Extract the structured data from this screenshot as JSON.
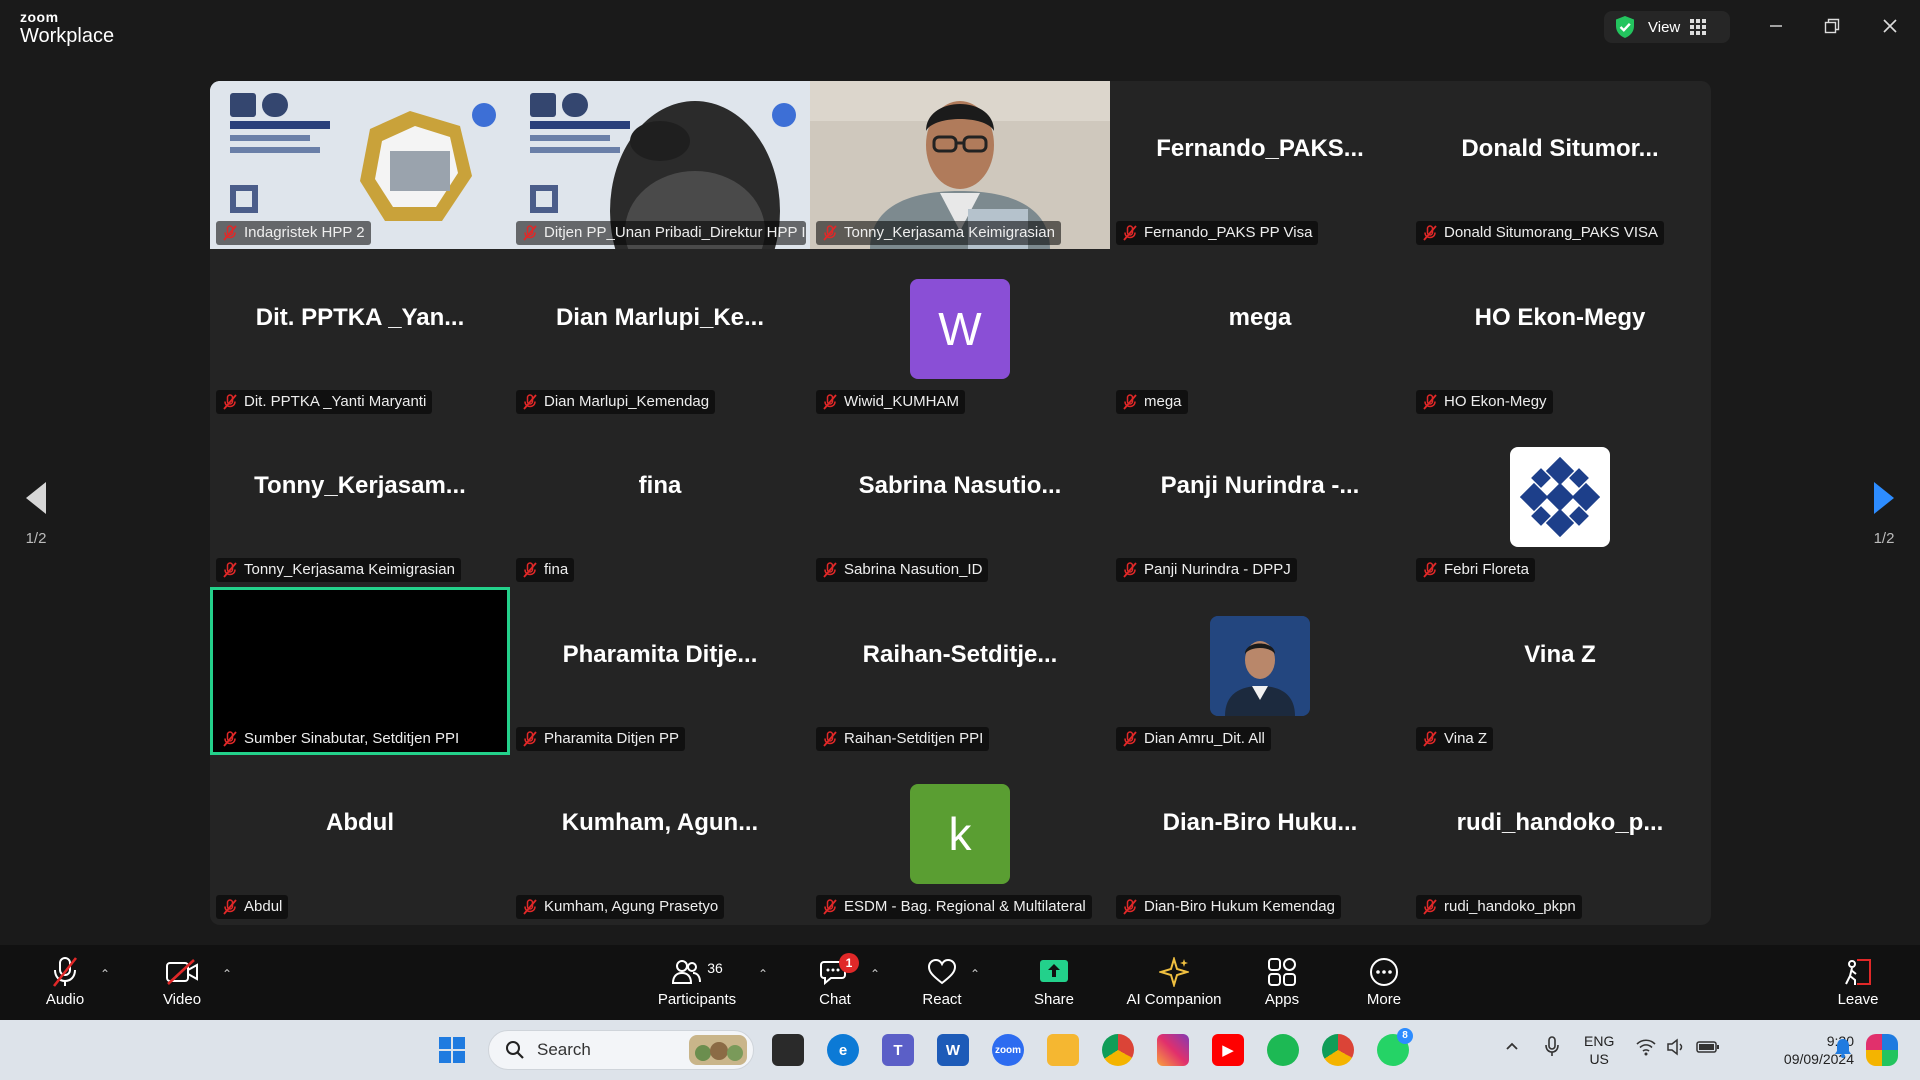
{
  "app": {
    "brand_top": "zoom",
    "brand_bottom": "Workplace",
    "view_label": "View"
  },
  "colors": {
    "active_border": "#23d18b",
    "purple_avatar": "#8a4fd6",
    "green_avatar": "#5a9e32",
    "share_green": "#23d18b",
    "muted_red": "#e02828",
    "nav_blue": "#2d8cff"
  },
  "page_indicator": {
    "left": "1/2",
    "right": "1/2"
  },
  "tiles": [
    {
      "display": "",
      "label": "Indagristek HPP 2",
      "kind": "slide"
    },
    {
      "display": "",
      "label": "Ditjen PP_Unan Pribadi_Direktur HPP II",
      "kind": "slide2"
    },
    {
      "display": "",
      "label": "Tonny_Kerjasama Keimigrasian",
      "kind": "person"
    },
    {
      "display": "Fernando_PAKS...",
      "label": "Fernando_PAKS PP Visa",
      "kind": "name"
    },
    {
      "display": "Donald  Situmor...",
      "label": "Donald Situmorang_PAKS VISA",
      "kind": "name"
    },
    {
      "display": "Dit.  PPTKA  _Yan...",
      "label": "Dit. PPTKA _Yanti Maryanti",
      "kind": "name"
    },
    {
      "display": "Dian  Marlupi_Ke...",
      "label": "Dian Marlupi_Kemendag",
      "kind": "name"
    },
    {
      "display": "W",
      "label": "Wiwid_KUMHAM",
      "kind": "avatar-purple"
    },
    {
      "display": "mega",
      "label": "mega",
      "kind": "name"
    },
    {
      "display": "HO  Ekon-Megy",
      "label": "HO Ekon-Megy",
      "kind": "name"
    },
    {
      "display": "Tonny_Kerjasam...",
      "label": "Tonny_Kerjasama Keimigrasian",
      "kind": "name"
    },
    {
      "display": "fina",
      "label": "fina",
      "kind": "name"
    },
    {
      "display": "Sabrina  Nasutio...",
      "label": "Sabrina Nasution_ID",
      "kind": "name"
    },
    {
      "display": "Panji  Nurindra  -...",
      "label": "Panji Nurindra - DPPJ",
      "kind": "name"
    },
    {
      "display": "",
      "label": "Febri Floreta",
      "kind": "logo"
    },
    {
      "display": "",
      "label": "Sumber Sinabutar, Setditjen PPI",
      "kind": "active"
    },
    {
      "display": "Pharamita  Ditje...",
      "label": "Pharamita Ditjen PP",
      "kind": "name"
    },
    {
      "display": "Raihan-Setditje...",
      "label": "Raihan-Setditjen PPI",
      "kind": "name"
    },
    {
      "display": "",
      "label": "Dian Amru_Dit. All",
      "kind": "photo"
    },
    {
      "display": "Vina Z",
      "label": "Vina Z",
      "kind": "name"
    },
    {
      "display": "Abdul",
      "label": "Abdul",
      "kind": "name"
    },
    {
      "display": "Kumham,  Agun...",
      "label": "Kumham, Agung Prasetyo",
      "kind": "name"
    },
    {
      "display": "k",
      "label": "ESDM - Bag. Regional & Multilateral",
      "kind": "avatar-green"
    },
    {
      "display": "Dian-Biro  Huku...",
      "label": "Dian-Biro Hukum Kemendag",
      "kind": "name"
    },
    {
      "display": "rudi_handoko_p...",
      "label": "rudi_handoko_pkpn",
      "kind": "name"
    }
  ],
  "toolbar": {
    "audio": "Audio",
    "video": "Video",
    "participants": "Participants",
    "participants_count": "36",
    "chat": "Chat",
    "chat_badge": "1",
    "react": "React",
    "share": "Share",
    "ai": "AI Companion",
    "apps": "Apps",
    "more": "More",
    "leave": "Leave"
  },
  "taskbar": {
    "search": "Search",
    "lang_top": "ENG",
    "lang_bottom": "US",
    "time": "9:20",
    "date": "09/09/2024",
    "whatsapp_badge": "8",
    "zoom_text": "zoom"
  }
}
